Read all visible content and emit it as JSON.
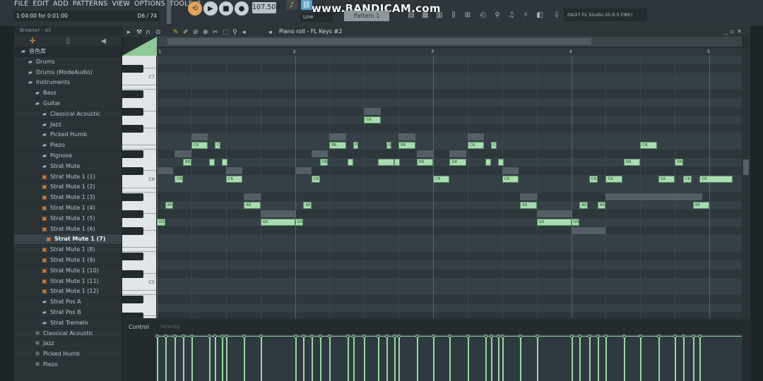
{
  "menu": [
    "FILE",
    "EDIT",
    "ADD",
    "PATTERNS",
    "VIEW",
    "OPTIONS",
    "TOOLS",
    "?"
  ],
  "hint": {
    "left": "1:04:00 for 0:01:00",
    "right": "D6 / 74"
  },
  "transport": {
    "tempo": "107.500",
    "time": "1:01:00"
  },
  "watermark": "www.BANDICAM.com",
  "pattern": "Pattern 1",
  "snap": "Line",
  "news": "09/27  FL Studio 20.0.5 FIRE!",
  "browser": {
    "header": "Browser - All",
    "items": [
      {
        "label": "音色库",
        "type": "folder",
        "indent": 0
      },
      {
        "label": "Drums",
        "type": "folder",
        "indent": 1
      },
      {
        "label": "Drums (ModeAudio)",
        "type": "folder",
        "indent": 1
      },
      {
        "label": "Instruments",
        "type": "folder",
        "indent": 1
      },
      {
        "label": "Bass",
        "type": "folder",
        "indent": 2
      },
      {
        "label": "Guitar",
        "type": "folder",
        "indent": 2
      },
      {
        "label": "Classical Acoustic",
        "type": "folder",
        "indent": 3
      },
      {
        "label": "Jazz",
        "type": "folder",
        "indent": 3
      },
      {
        "label": "Picked Humb",
        "type": "folder",
        "indent": 3
      },
      {
        "label": "Piezo",
        "type": "folder",
        "indent": 3
      },
      {
        "label": "Pignose",
        "type": "folder",
        "indent": 3
      },
      {
        "label": "Strat Mute",
        "type": "folder",
        "indent": 3
      },
      {
        "label": "Strat Mute 1 (1)",
        "type": "file",
        "indent": 3
      },
      {
        "label": "Strat Mute 1 (2)",
        "type": "file",
        "indent": 3
      },
      {
        "label": "Strat Mute 1 (3)",
        "type": "file",
        "indent": 3
      },
      {
        "label": "Strat Mute 1 (4)",
        "type": "file",
        "indent": 3
      },
      {
        "label": "Strat Mute 1 (5)",
        "type": "file",
        "indent": 3
      },
      {
        "label": "Strat Mute 1 (6)",
        "type": "file",
        "indent": 3
      },
      {
        "label": "Strat Mute 1 (7)",
        "type": "file",
        "indent": 3,
        "selected": true
      },
      {
        "label": "Strat Mute 1 (8)",
        "type": "file",
        "indent": 3
      },
      {
        "label": "Strat Mute 1 (9)",
        "type": "file",
        "indent": 3
      },
      {
        "label": "Strat Mute 1 (10)",
        "type": "file",
        "indent": 3
      },
      {
        "label": "Strat Mute 1 (11)",
        "type": "file",
        "indent": 3
      },
      {
        "label": "Strat Mute 1 (12)",
        "type": "file",
        "indent": 3
      },
      {
        "label": "Strat Pos A",
        "type": "folder",
        "indent": 3
      },
      {
        "label": "Strat Pos B",
        "type": "folder",
        "indent": 3
      },
      {
        "label": "Strat Tremelo",
        "type": "folder",
        "indent": 3
      },
      {
        "label": "Classical Acoustic",
        "type": "plugin",
        "indent": 2
      },
      {
        "label": "Jazz",
        "type": "plugin",
        "indent": 2
      },
      {
        "label": "Picked Humb",
        "type": "plugin",
        "indent": 2
      },
      {
        "label": "Piezo",
        "type": "plugin",
        "indent": 2
      }
    ]
  },
  "piano_roll": {
    "title": "Piano roll - FL Keys #2",
    "bars": [
      "1",
      "2",
      "3",
      "4",
      "5"
    ],
    "key_labels": [
      "C7",
      "C6",
      "C5"
    ],
    "control_label": "Control",
    "control_target": "Velocity",
    "notes": [
      {
        "label": "G6",
        "bar": 2.5,
        "len": 0.12,
        "pitch": "G6"
      },
      {
        "label": "C6",
        "bar": 1.25,
        "len": 0.12,
        "pitch": "E6"
      },
      {
        "label": "C",
        "bar": 1.42,
        "len": 0.04,
        "pitch": "E6"
      },
      {
        "label": "E6",
        "bar": 2.25,
        "len": 0.12,
        "pitch": "E6"
      },
      {
        "label": "F",
        "bar": 2.42,
        "len": 0.04,
        "pitch": "E6"
      },
      {
        "label": "G",
        "bar": 2.66,
        "len": 0.04,
        "pitch": "E6"
      },
      {
        "label": "E6",
        "bar": 2.75,
        "len": 0.12,
        "pitch": "E6"
      },
      {
        "label": "C6",
        "bar": 3.25,
        "len": 0.12,
        "pitch": "E6"
      },
      {
        "label": "C",
        "bar": 3.42,
        "len": 0.04,
        "pitch": "E6"
      },
      {
        "label": "C6",
        "bar": 4.5,
        "len": 0.12,
        "pitch": "E6"
      },
      {
        "label": "B5",
        "bar": 1.19,
        "len": 0.06,
        "pitch": "D6"
      },
      {
        "label": "",
        "bar": 1.38,
        "len": 0.04,
        "pitch": "D6"
      },
      {
        "label": "",
        "bar": 1.47,
        "len": 0.04,
        "pitch": "D6"
      },
      {
        "label": "D6",
        "bar": 2.18,
        "len": 0.06,
        "pitch": "D6"
      },
      {
        "label": "",
        "bar": 2.38,
        "len": 0.04,
        "pitch": "D6"
      },
      {
        "label": "",
        "bar": 2.6,
        "len": 0.12,
        "pitch": "D6"
      },
      {
        "label": "",
        "bar": 2.72,
        "len": 0.04,
        "pitch": "D6"
      },
      {
        "label": "D6",
        "bar": 2.88,
        "len": 0.12,
        "pitch": "D6"
      },
      {
        "label": "D6",
        "bar": 3.12,
        "len": 0.12,
        "pitch": "D6"
      },
      {
        "label": "",
        "bar": 3.38,
        "len": 0.04,
        "pitch": "D6"
      },
      {
        "label": "",
        "bar": 3.47,
        "len": 0.04,
        "pitch": "D6"
      },
      {
        "label": "D6",
        "bar": 4.38,
        "len": 0.12,
        "pitch": "D6"
      },
      {
        "label": "D6",
        "bar": 4.75,
        "len": 0.06,
        "pitch": "D6"
      },
      {
        "label": "C6",
        "bar": 1.13,
        "len": 0.06,
        "pitch": "C6"
      },
      {
        "label": "C6",
        "bar": 1.5,
        "len": 0.12,
        "pitch": "C6"
      },
      {
        "label": "C6",
        "bar": 2.12,
        "len": 0.06,
        "pitch": "C6"
      },
      {
        "label": "C6",
        "bar": 3.0,
        "len": 0.12,
        "pitch": "C6"
      },
      {
        "label": "C6",
        "bar": 3.5,
        "len": 0.12,
        "pitch": "C6"
      },
      {
        "label": "C6",
        "bar": 4.13,
        "len": 0.06,
        "pitch": "C6"
      },
      {
        "label": "C6",
        "bar": 4.25,
        "len": 0.12,
        "pitch": "C6"
      },
      {
        "label": "C6",
        "bar": 4.63,
        "len": 0.12,
        "pitch": "C6"
      },
      {
        "label": "C6",
        "bar": 4.81,
        "len": 0.06,
        "pitch": "C6"
      },
      {
        "label": "C6",
        "bar": 4.93,
        "len": 0.24,
        "pitch": "C6"
      },
      {
        "label": "A5",
        "bar": 1.06,
        "len": 0.06,
        "pitch": "A5"
      },
      {
        "label": "A5",
        "bar": 1.63,
        "len": 0.12,
        "pitch": "A5"
      },
      {
        "label": "A5",
        "bar": 2.06,
        "len": 0.06,
        "pitch": "A5"
      },
      {
        "label": "A5",
        "bar": 3.63,
        "len": 0.12,
        "pitch": "A5"
      },
      {
        "label": "A5",
        "bar": 4.06,
        "len": 0.06,
        "pitch": "A5"
      },
      {
        "label": "A5",
        "bar": 4.19,
        "len": 0.06,
        "pitch": "A5"
      },
      {
        "label": "A5",
        "bar": 4.88,
        "len": 0.12,
        "pitch": "A5"
      },
      {
        "label": "G5",
        "bar": 1.0,
        "len": 0.06,
        "pitch": "G5"
      },
      {
        "label": "G5",
        "bar": 1.75,
        "len": 0.25,
        "pitch": "G5"
      },
      {
        "label": "G5",
        "bar": 2.0,
        "len": 0.06,
        "pitch": "G5"
      },
      {
        "label": "G5",
        "bar": 3.75,
        "len": 0.25,
        "pitch": "G5"
      },
      {
        "label": "G5",
        "bar": 4.0,
        "len": 0.06,
        "pitch": "G5"
      }
    ]
  },
  "colors": {
    "note": "#a8dcb1",
    "grid": "#344046",
    "accent": "#e3b544"
  }
}
